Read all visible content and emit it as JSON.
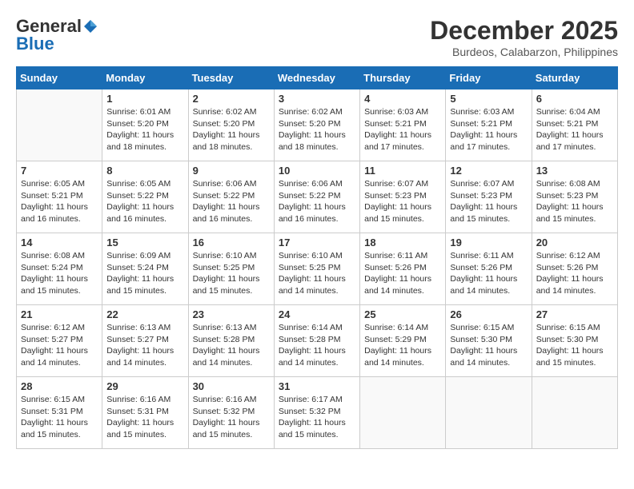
{
  "header": {
    "logo_general": "General",
    "logo_blue": "Blue",
    "month_title": "December 2025",
    "location": "Burdeos, Calabarzon, Philippines"
  },
  "days_of_week": [
    "Sunday",
    "Monday",
    "Tuesday",
    "Wednesday",
    "Thursday",
    "Friday",
    "Saturday"
  ],
  "weeks": [
    [
      {
        "day": "",
        "empty": true
      },
      {
        "day": "1",
        "sunrise": "6:01 AM",
        "sunset": "5:20 PM",
        "daylight": "11 hours and 18 minutes."
      },
      {
        "day": "2",
        "sunrise": "6:02 AM",
        "sunset": "5:20 PM",
        "daylight": "11 hours and 18 minutes."
      },
      {
        "day": "3",
        "sunrise": "6:02 AM",
        "sunset": "5:20 PM",
        "daylight": "11 hours and 18 minutes."
      },
      {
        "day": "4",
        "sunrise": "6:03 AM",
        "sunset": "5:21 PM",
        "daylight": "11 hours and 17 minutes."
      },
      {
        "day": "5",
        "sunrise": "6:03 AM",
        "sunset": "5:21 PM",
        "daylight": "11 hours and 17 minutes."
      },
      {
        "day": "6",
        "sunrise": "6:04 AM",
        "sunset": "5:21 PM",
        "daylight": "11 hours and 17 minutes."
      }
    ],
    [
      {
        "day": "7",
        "sunrise": "6:05 AM",
        "sunset": "5:21 PM",
        "daylight": "11 hours and 16 minutes."
      },
      {
        "day": "8",
        "sunrise": "6:05 AM",
        "sunset": "5:22 PM",
        "daylight": "11 hours and 16 minutes."
      },
      {
        "day": "9",
        "sunrise": "6:06 AM",
        "sunset": "5:22 PM",
        "daylight": "11 hours and 16 minutes."
      },
      {
        "day": "10",
        "sunrise": "6:06 AM",
        "sunset": "5:22 PM",
        "daylight": "11 hours and 16 minutes."
      },
      {
        "day": "11",
        "sunrise": "6:07 AM",
        "sunset": "5:23 PM",
        "daylight": "11 hours and 15 minutes."
      },
      {
        "day": "12",
        "sunrise": "6:07 AM",
        "sunset": "5:23 PM",
        "daylight": "11 hours and 15 minutes."
      },
      {
        "day": "13",
        "sunrise": "6:08 AM",
        "sunset": "5:23 PM",
        "daylight": "11 hours and 15 minutes."
      }
    ],
    [
      {
        "day": "14",
        "sunrise": "6:08 AM",
        "sunset": "5:24 PM",
        "daylight": "11 hours and 15 minutes."
      },
      {
        "day": "15",
        "sunrise": "6:09 AM",
        "sunset": "5:24 PM",
        "daylight": "11 hours and 15 minutes."
      },
      {
        "day": "16",
        "sunrise": "6:10 AM",
        "sunset": "5:25 PM",
        "daylight": "11 hours and 15 minutes."
      },
      {
        "day": "17",
        "sunrise": "6:10 AM",
        "sunset": "5:25 PM",
        "daylight": "11 hours and 14 minutes."
      },
      {
        "day": "18",
        "sunrise": "6:11 AM",
        "sunset": "5:26 PM",
        "daylight": "11 hours and 14 minutes."
      },
      {
        "day": "19",
        "sunrise": "6:11 AM",
        "sunset": "5:26 PM",
        "daylight": "11 hours and 14 minutes."
      },
      {
        "day": "20",
        "sunrise": "6:12 AM",
        "sunset": "5:26 PM",
        "daylight": "11 hours and 14 minutes."
      }
    ],
    [
      {
        "day": "21",
        "sunrise": "6:12 AM",
        "sunset": "5:27 PM",
        "daylight": "11 hours and 14 minutes."
      },
      {
        "day": "22",
        "sunrise": "6:13 AM",
        "sunset": "5:27 PM",
        "daylight": "11 hours and 14 minutes."
      },
      {
        "day": "23",
        "sunrise": "6:13 AM",
        "sunset": "5:28 PM",
        "daylight": "11 hours and 14 minutes."
      },
      {
        "day": "24",
        "sunrise": "6:14 AM",
        "sunset": "5:28 PM",
        "daylight": "11 hours and 14 minutes."
      },
      {
        "day": "25",
        "sunrise": "6:14 AM",
        "sunset": "5:29 PM",
        "daylight": "11 hours and 14 minutes."
      },
      {
        "day": "26",
        "sunrise": "6:15 AM",
        "sunset": "5:30 PM",
        "daylight": "11 hours and 14 minutes."
      },
      {
        "day": "27",
        "sunrise": "6:15 AM",
        "sunset": "5:30 PM",
        "daylight": "11 hours and 15 minutes."
      }
    ],
    [
      {
        "day": "28",
        "sunrise": "6:15 AM",
        "sunset": "5:31 PM",
        "daylight": "11 hours and 15 minutes."
      },
      {
        "day": "29",
        "sunrise": "6:16 AM",
        "sunset": "5:31 PM",
        "daylight": "11 hours and 15 minutes."
      },
      {
        "day": "30",
        "sunrise": "6:16 AM",
        "sunset": "5:32 PM",
        "daylight": "11 hours and 15 minutes."
      },
      {
        "day": "31",
        "sunrise": "6:17 AM",
        "sunset": "5:32 PM",
        "daylight": "11 hours and 15 minutes."
      },
      {
        "day": "",
        "empty": true
      },
      {
        "day": "",
        "empty": true
      },
      {
        "day": "",
        "empty": true
      }
    ]
  ]
}
